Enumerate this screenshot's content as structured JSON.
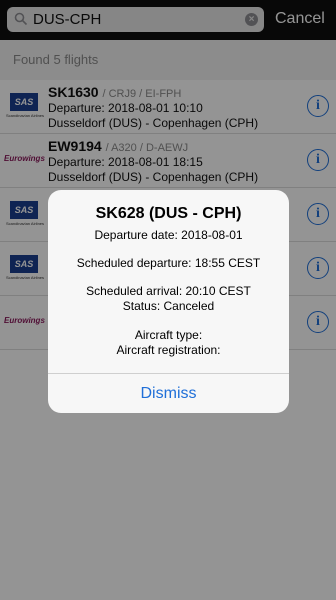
{
  "search": {
    "query": "DUS-CPH",
    "cancel_label": "Cancel"
  },
  "found_label": "Found 5 flights",
  "rows": [
    {
      "flight": "SK1630",
      "reg": "/ CRJ9 / EI-FPH",
      "departure": "Departure: 2018-08-01 10:10",
      "route": "Dusseldorf (DUS) - Copenhagen (CPH)",
      "airline": "SAS"
    },
    {
      "flight": "EW9194",
      "reg": "/ A320 / D-AEWJ",
      "departure": "Departure: 2018-08-01 18:15",
      "route": "Dusseldorf (DUS) - Copenhagen (CPH)",
      "airline": "Eurowings"
    },
    {
      "airline": "SAS"
    },
    {
      "airline": "SAS"
    },
    {
      "airline": "Eurowings"
    }
  ],
  "logos": {
    "sas": "SAS",
    "sas_sub": "Scandinavian Airlines",
    "eurowings": "Eurowings"
  },
  "alert": {
    "title": "SK628 (DUS - CPH)",
    "departure_date": "Departure date: 2018-08-01",
    "scheduled_departure": "Scheduled departure: 18:55 CEST",
    "scheduled_arrival": "Scheduled arrival: 20:10 CEST",
    "status": "Status: Canceled",
    "aircraft_type": "Aircraft type:",
    "aircraft_registration": "Aircraft registration:",
    "dismiss_label": "Dismiss"
  },
  "colors": {
    "accent": "#1f6fd8",
    "sas_blue": "#1b3f8f",
    "eurowings": "#8b1a5c"
  }
}
